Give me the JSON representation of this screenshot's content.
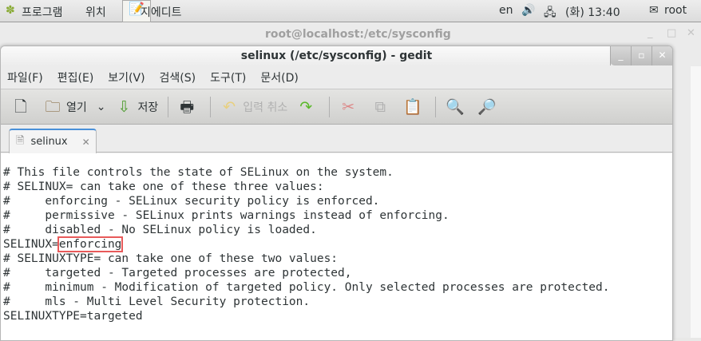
{
  "topbar": {
    "applications": "프로그램",
    "places": "위치",
    "app_name": "지에디트",
    "lang": "en",
    "clock": "(화) 13:40",
    "user": "root"
  },
  "background_window": {
    "title": "root@localhost:/etc/sysconfig"
  },
  "window": {
    "title": "selinux (/etc/sysconfig) - gedit"
  },
  "menu": [
    "파일(F)",
    "편집(E)",
    "보기(V)",
    "검색(S)",
    "도구(T)",
    "문서(D)"
  ],
  "toolbar": {
    "open": "열기",
    "save": "저장",
    "undo": "입력 취소"
  },
  "tab": {
    "label": "selinux"
  },
  "editor": {
    "lines": [
      "# This file controls the state of SELinux on the system.",
      "# SELINUX= can take one of these three values:",
      "#     enforcing - SELinux security policy is enforced.",
      "#     permissive - SELinux prints warnings instead of enforcing.",
      "#     disabled - No SELinux policy is loaded.",
      "SELINUX=",
      "# SELINUXTYPE= can take one of these two values:",
      "#     targeted - Targeted processes are protected,",
      "#     minimum - Modification of targeted policy. Only selected processes are protected.",
      "#     mls - Multi Level Security protection.",
      "SELINUXTYPE=targeted"
    ],
    "highlighted_value": "enforcing",
    "highlight_color": "#e85a5a"
  }
}
